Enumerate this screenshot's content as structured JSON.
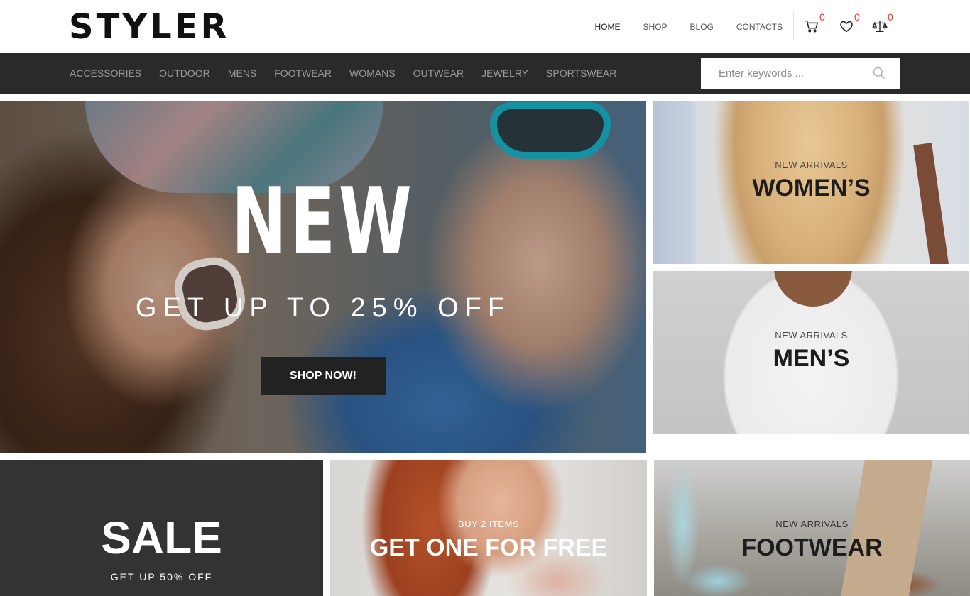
{
  "header": {
    "logo": "STYLER",
    "nav": [
      {
        "label": "HOME"
      },
      {
        "label": "SHOP"
      },
      {
        "label": "BLOG"
      },
      {
        "label": "CONTACTS"
      }
    ],
    "cart_count": "0",
    "wishlist_count": "0",
    "compare_count": "0",
    "icons": [
      "cart-icon",
      "heart-icon",
      "scales-icon"
    ]
  },
  "categories": [
    "ACCESSORIES",
    "OUTDOOR",
    "MENS",
    "FOOTWEAR",
    "WOMANS",
    "OUTWEAR",
    "JEWELRY",
    "SPORTSWEAR"
  ],
  "search": {
    "placeholder": "Enter keywords ..."
  },
  "hero": {
    "title": "NEW",
    "subtitle": "GET UP TO 25% OFF",
    "button": "SHOP NOW!"
  },
  "tiles": {
    "women": {
      "label": "NEW ARRIVALS",
      "title": "WOMEN’S"
    },
    "men": {
      "label": "NEW ARRIVALS",
      "title": "MEN’S"
    },
    "sale": {
      "title": "SALE",
      "label": "GET UP 50% OFF"
    },
    "free": {
      "label": "BUY 2 ITEMS",
      "title": "GET ONE FOR FREE"
    },
    "footwear": {
      "label": "NEW ARRIVALS",
      "title": "FOOTWEAR"
    }
  },
  "colors": {
    "topbar": "#2a2a2a",
    "badge": "#e53935",
    "button": "#222222"
  }
}
